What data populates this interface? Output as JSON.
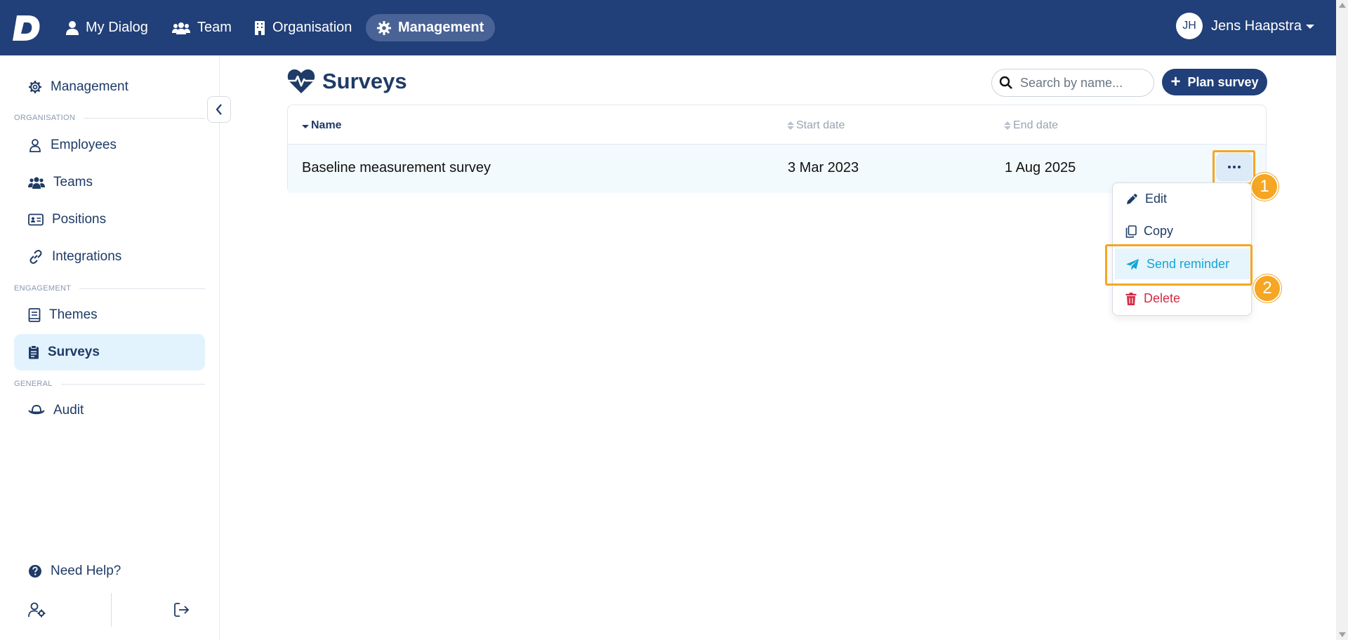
{
  "topbar": {
    "nav": [
      {
        "label": "My Dialog"
      },
      {
        "label": "Team"
      },
      {
        "label": "Organisation"
      },
      {
        "label": "Management"
      }
    ],
    "user": {
      "initials": "JH",
      "name": "Jens Haapstra"
    }
  },
  "sidebar": {
    "management": "Management",
    "sections": {
      "organisation": "ORGANISATION",
      "engagement": "ENGAGEMENT",
      "general": "GENERAL"
    },
    "items": {
      "employees": "Employees",
      "teams": "Teams",
      "positions": "Positions",
      "integrations": "Integrations",
      "themes": "Themes",
      "surveys": "Surveys",
      "audit": "Audit"
    },
    "help": "Need Help?"
  },
  "main": {
    "title": "Surveys",
    "search_placeholder": "Search by name...",
    "plan_button": "Plan survey",
    "table": {
      "headers": {
        "name": "Name",
        "start": "Start date",
        "end": "End date"
      },
      "rows": [
        {
          "name": "Baseline measurement survey",
          "start": "3 Mar 2023",
          "end": "1 Aug 2025"
        }
      ]
    },
    "menu": {
      "edit": "Edit",
      "copy": "Copy",
      "send_reminder": "Send reminder",
      "delete": "Delete"
    },
    "badges": [
      "1",
      "2"
    ]
  }
}
